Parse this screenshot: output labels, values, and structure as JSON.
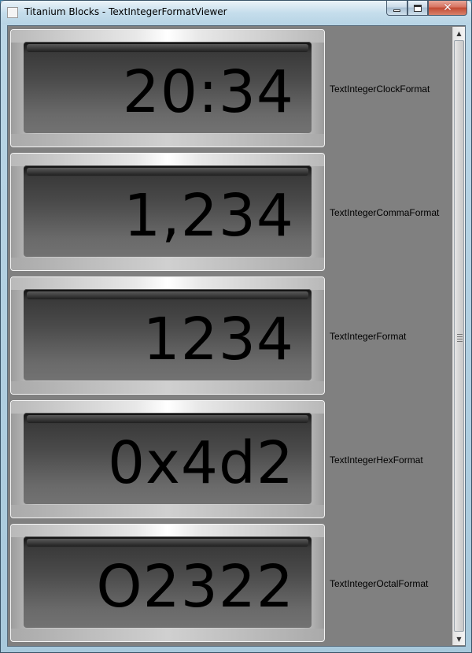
{
  "window": {
    "title": "Titanium Blocks - TextIntegerFormatViewer",
    "buttons": {
      "minimize": "minimize",
      "maximize": "maximize",
      "close": "close"
    }
  },
  "rows": [
    {
      "value": "20:34",
      "label": "TextIntegerClockFormat"
    },
    {
      "value": "1,234",
      "label": "TextIntegerCommaFormat"
    },
    {
      "value": "1234",
      "label": "TextIntegerFormat"
    },
    {
      "value": "0x4d2",
      "label": "TextIntegerHexFormat"
    },
    {
      "value": "O2322",
      "label": "TextIntegerOctalFormat"
    }
  ],
  "scrollbar": {
    "up_glyph": "▲",
    "down_glyph": "▼"
  }
}
